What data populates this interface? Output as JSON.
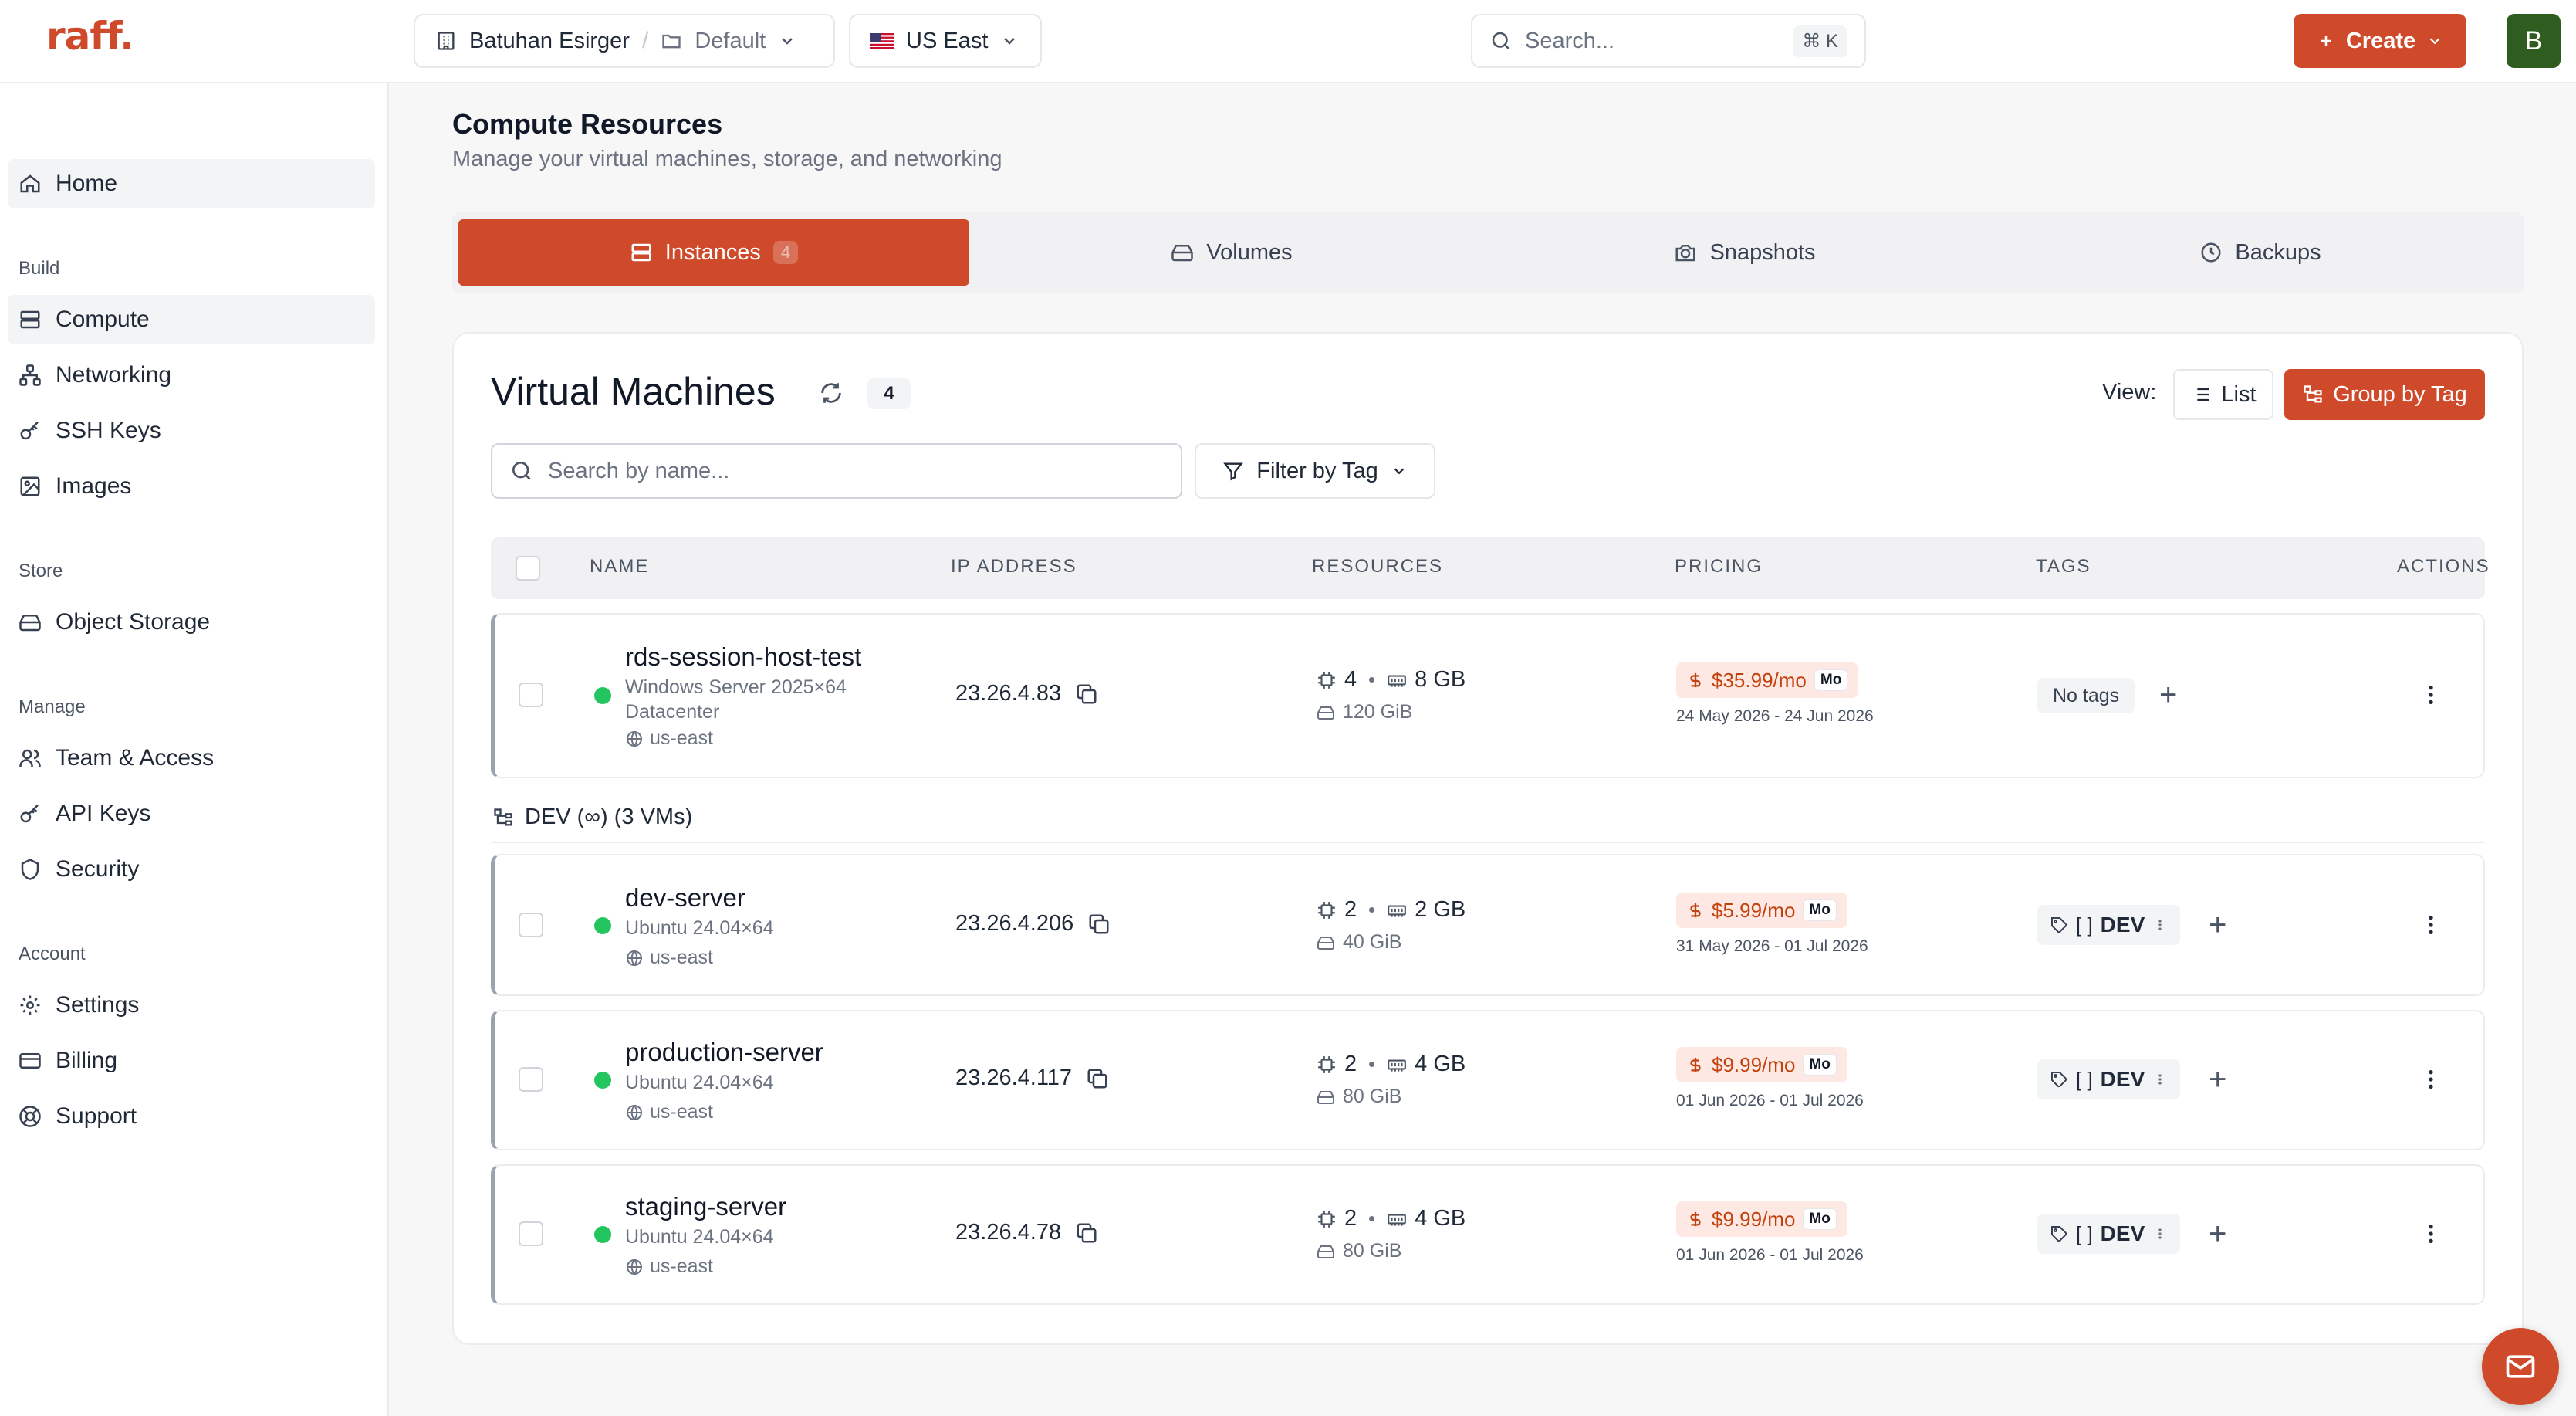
{
  "brand": {
    "logo": "raff."
  },
  "header": {
    "org": "Batuhan Esirger",
    "project": "Default",
    "region": "US East",
    "region_flag": "🇺🇸",
    "search_placeholder": "Search...",
    "search_shortcut": "⌘ K",
    "create_label": "Create",
    "avatar_initial": "B"
  },
  "sidebar": {
    "home": "Home",
    "sections": {
      "build": "Build",
      "store": "Store",
      "manage": "Manage",
      "account": "Account"
    },
    "items": {
      "compute": "Compute",
      "networking": "Networking",
      "ssh_keys": "SSH Keys",
      "images": "Images",
      "object_storage": "Object Storage",
      "team_access": "Team & Access",
      "api_keys": "API Keys",
      "security": "Security",
      "settings": "Settings",
      "billing": "Billing",
      "support": "Support"
    }
  },
  "page": {
    "title": "Compute Resources",
    "subtitle": "Manage your virtual machines, storage, and networking"
  },
  "tabs": {
    "instances": "Instances",
    "instances_count": "4",
    "volumes": "Volumes",
    "snapshots": "Snapshots",
    "backups": "Backups"
  },
  "vm_panel": {
    "title": "Virtual Machines",
    "count": "4",
    "view_label": "View:",
    "view_list": "List",
    "view_group": "Group by Tag",
    "search_placeholder": "Search by name...",
    "filter_label": "Filter by Tag"
  },
  "table": {
    "headers": {
      "name": "NAME",
      "ip": "IP ADDRESS",
      "resources": "RESOURCES",
      "pricing": "PRICING",
      "tags": "TAGS",
      "actions": "ACTIONS"
    },
    "no_tags": "No tags",
    "mo_label": "Mo",
    "group_label": "DEV (∞) (3 VMs)",
    "rows": [
      {
        "name": "rds-session-host-test",
        "os_line1": "Windows Server 2025×64",
        "os_line2": "Datacenter",
        "region": "us-east",
        "ip": "23.26.4.83",
        "cpu": "4",
        "ram": "8 GB",
        "disk": "120 GiB",
        "price": "$35.99/mo",
        "period": "24 May 2026 - 24 Jun 2026"
      },
      {
        "name": "dev-server",
        "os_line1": "Ubuntu 24.04×64",
        "region": "us-east",
        "ip": "23.26.4.206",
        "cpu": "2",
        "ram": "2 GB",
        "disk": "40 GiB",
        "price": "$5.99/mo",
        "period": "31 May 2026 - 01 Jul 2026",
        "tag": "DEV",
        "tag_bracket": "[ ]"
      },
      {
        "name": "production-server",
        "os_line1": "Ubuntu 24.04×64",
        "region": "us-east",
        "ip": "23.26.4.117",
        "cpu": "2",
        "ram": "4 GB",
        "disk": "80 GiB",
        "price": "$9.99/mo",
        "period": "01 Jun 2026 - 01 Jul 2026",
        "tag": "DEV",
        "tag_bracket": "[ ]"
      },
      {
        "name": "staging-server",
        "os_line1": "Ubuntu 24.04×64",
        "region": "us-east",
        "ip": "23.26.4.78",
        "cpu": "2",
        "ram": "4 GB",
        "disk": "80 GiB",
        "price": "$9.99/mo",
        "period": "01 Jun 2026 - 01 Jul 2026",
        "tag": "DEV",
        "tag_bracket": "[ ]"
      }
    ]
  },
  "colors": {
    "accent": "#cf4a2b",
    "status_running": "#22c55e",
    "price_bg": "#fde8e3"
  }
}
